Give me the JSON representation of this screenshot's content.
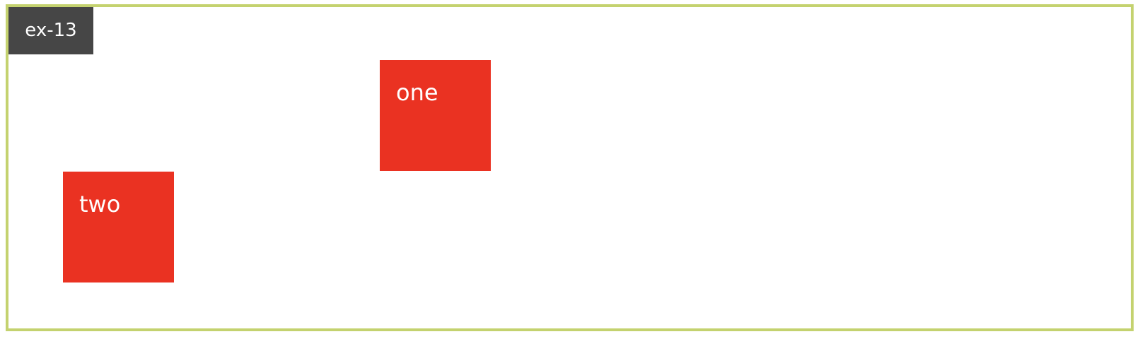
{
  "example": {
    "label": "ex-13"
  },
  "boxes": {
    "one": "one",
    "two": "two"
  },
  "colors": {
    "frame_border": "#c4d26f",
    "tag_background": "#464646",
    "box_background": "#ea3222",
    "box_text": "#ffffff"
  }
}
